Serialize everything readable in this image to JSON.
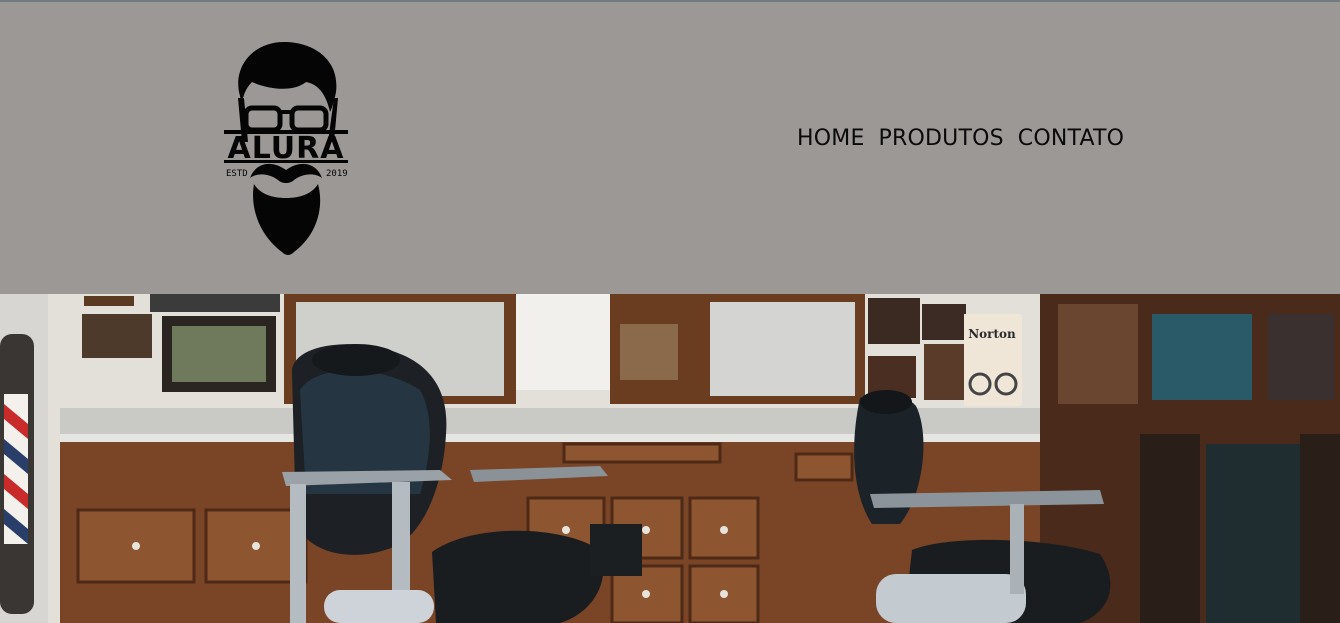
{
  "brand": {
    "name": "ALURA",
    "est_left": "ESTD",
    "est_right": "2019",
    "logo_icon": "bearded-man-with-glasses-logo"
  },
  "nav": {
    "items": [
      {
        "label": "HOME"
      },
      {
        "label": "PRODUTOS"
      },
      {
        "label": "CONTATO"
      }
    ]
  },
  "hero": {
    "image_icon": "barbershop-photo",
    "poster_text": "Norton"
  },
  "colors": {
    "header_bg": "#9c9896",
    "text": "#0a0a0a"
  }
}
